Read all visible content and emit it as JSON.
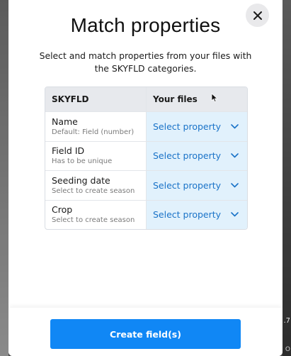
{
  "modal": {
    "title": "Match properties",
    "subtitle": "Select and match properties from your files with the SKYFLD categories."
  },
  "table": {
    "headers": {
      "left": "SKYFLD",
      "right": "Your files"
    },
    "rows": [
      {
        "name": "Name",
        "hint": "Default: Field (number)",
        "select": "Select property"
      },
      {
        "name": "Field ID",
        "hint": "Has to be unique",
        "select": "Select property"
      },
      {
        "name": "Seeding date",
        "hint": "Select to create season",
        "select": "Select property"
      },
      {
        "name": "Crop",
        "hint": "Select to create season",
        "select": "Select property"
      }
    ]
  },
  "footer": {
    "primary_label": "Create field(s)"
  },
  "background": {
    "peek_text": ".7",
    "peek_text2": "O"
  },
  "colors": {
    "accent": "#1087f5",
    "select_bg": "#e1f1fc",
    "select_text": "#1a73c8"
  }
}
